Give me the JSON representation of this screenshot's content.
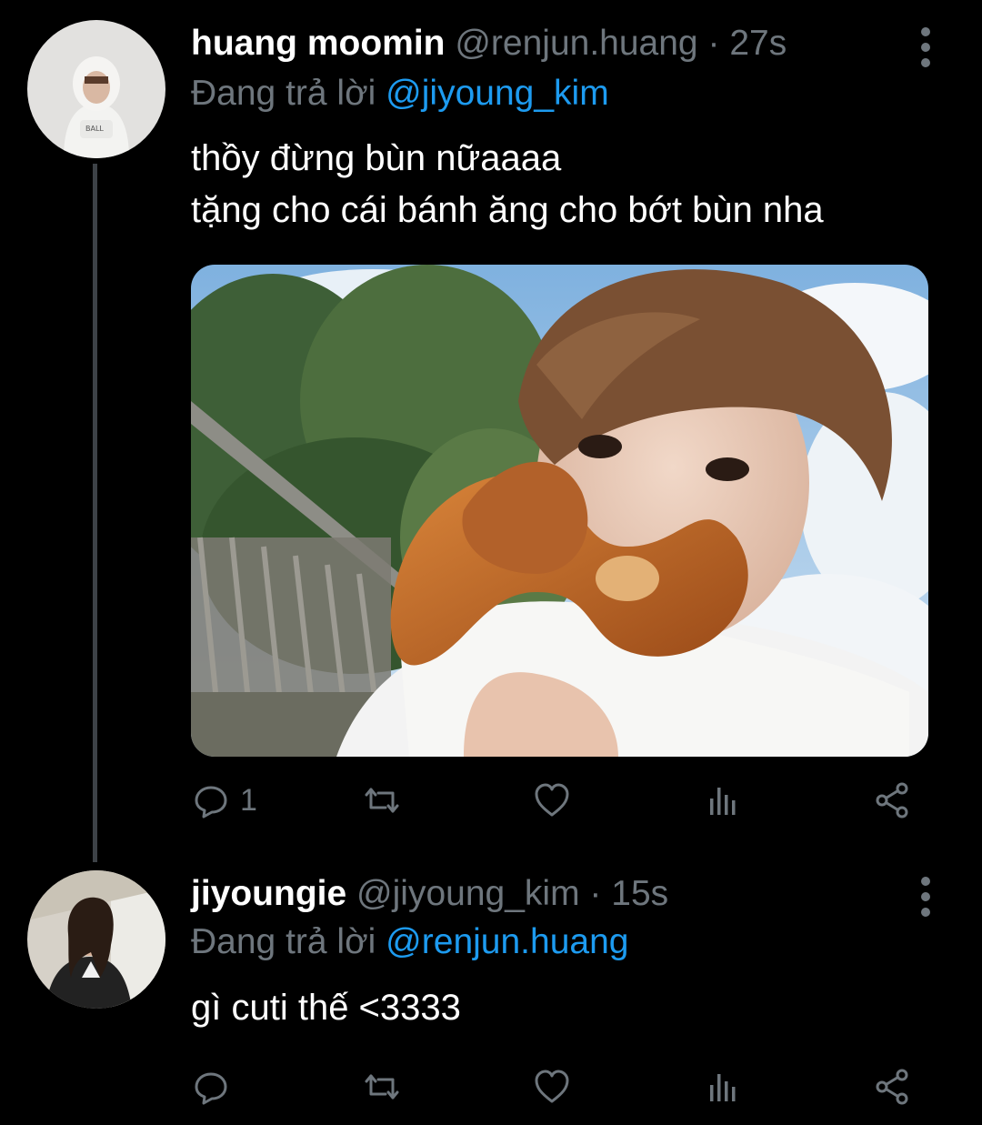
{
  "tweets": [
    {
      "display_name": "huang moomin",
      "handle": "@renjun.huang",
      "separator": "·",
      "time": "27s",
      "replying_prefix": "Đang trả lời",
      "replying_to": "@jiyoung_kim",
      "text_lines": [
        "thồy đừng bùn nữaaaa",
        "tặng cho cái bánh ăng cho bớt bùn nha"
      ],
      "reply_count": "1",
      "has_media": true
    },
    {
      "display_name": "jiyoungie",
      "handle": "@jiyoung_kim",
      "separator": "·",
      "time": "15s",
      "replying_prefix": "Đang trả lời",
      "replying_to": "@renjun.huang",
      "text_lines": [
        "gì cuti thế <3333"
      ],
      "reply_count": "",
      "has_media": false
    }
  ],
  "icons": {
    "reply": "comment-bubble-icon",
    "retweet": "retweet-icon",
    "like": "heart-icon",
    "analytics": "bar-chart-icon",
    "share": "share-icon",
    "more": "vertical-dots-icon"
  },
  "colors": {
    "background": "#000000",
    "secondary_text": "#6e767d",
    "accent": "#1d9bf0",
    "thread_line": "#3d4247"
  }
}
